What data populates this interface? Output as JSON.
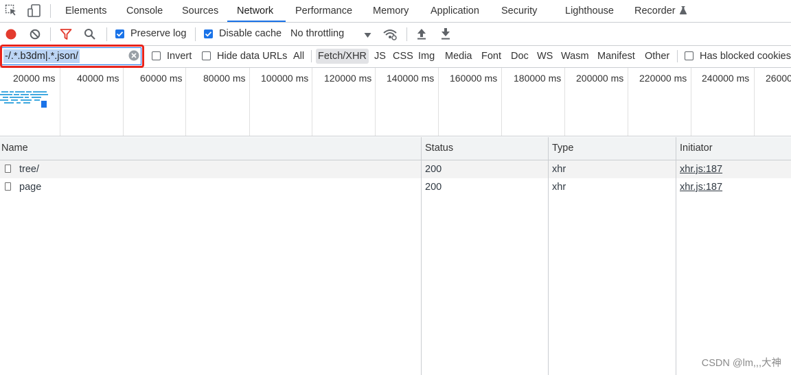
{
  "tabs": [
    {
      "id": "elements",
      "label": "Elements",
      "selected": false
    },
    {
      "id": "console",
      "label": "Console",
      "selected": false
    },
    {
      "id": "sources",
      "label": "Sources",
      "selected": false
    },
    {
      "id": "network",
      "label": "Network",
      "selected": true
    },
    {
      "id": "performance",
      "label": "Performance",
      "selected": false
    },
    {
      "id": "memory",
      "label": "Memory",
      "selected": false
    },
    {
      "id": "application",
      "label": "Application",
      "selected": false
    },
    {
      "id": "security",
      "label": "Security",
      "selected": false
    },
    {
      "id": "lighthouse",
      "label": "Lighthouse",
      "selected": false
    },
    {
      "id": "recorder",
      "label": "Recorder",
      "selected": false
    }
  ],
  "toolbar": {
    "preserve_log": {
      "label": "Preserve log",
      "checked": true
    },
    "disable_cache": {
      "label": "Disable cache",
      "checked": true
    },
    "throttling": "No throttling"
  },
  "filter": {
    "value": "-/.*.b3dm|.*.json/",
    "invert": {
      "label": "Invert",
      "checked": false
    },
    "hide_data_urls": {
      "label": "Hide data URLs",
      "checked": false
    },
    "types": [
      "All",
      "Fetch/XHR",
      "JS",
      "CSS",
      "Img",
      "Media",
      "Font",
      "Doc",
      "WS",
      "Wasm",
      "Manifest",
      "Other"
    ],
    "active_type": "Fetch/XHR",
    "has_blocked_cookies": {
      "label": "Has blocked cookies",
      "checked": false
    }
  },
  "overview": {
    "ticks": [
      "20000 ms",
      "40000 ms",
      "60000 ms",
      "80000 ms",
      "100000 ms",
      "120000 ms",
      "140000 ms",
      "160000 ms",
      "180000 ms",
      "200000 ms",
      "220000 ms",
      "240000 ms",
      "26000"
    ]
  },
  "table": {
    "columns": [
      "Name",
      "Status",
      "Type",
      "Initiator"
    ],
    "rows": [
      {
        "name": "tree/",
        "status": "200",
        "type": "xhr",
        "initiator": "xhr.js:187"
      },
      {
        "name": "page",
        "status": "200",
        "type": "xhr",
        "initiator": "xhr.js:187"
      }
    ]
  },
  "watermark": "CSDN @lm,,,大神",
  "colors": {
    "accent": "#1a73e8",
    "record": "#e33b2e",
    "highlight": "#e8241c",
    "selection": "#bcd5f5"
  }
}
